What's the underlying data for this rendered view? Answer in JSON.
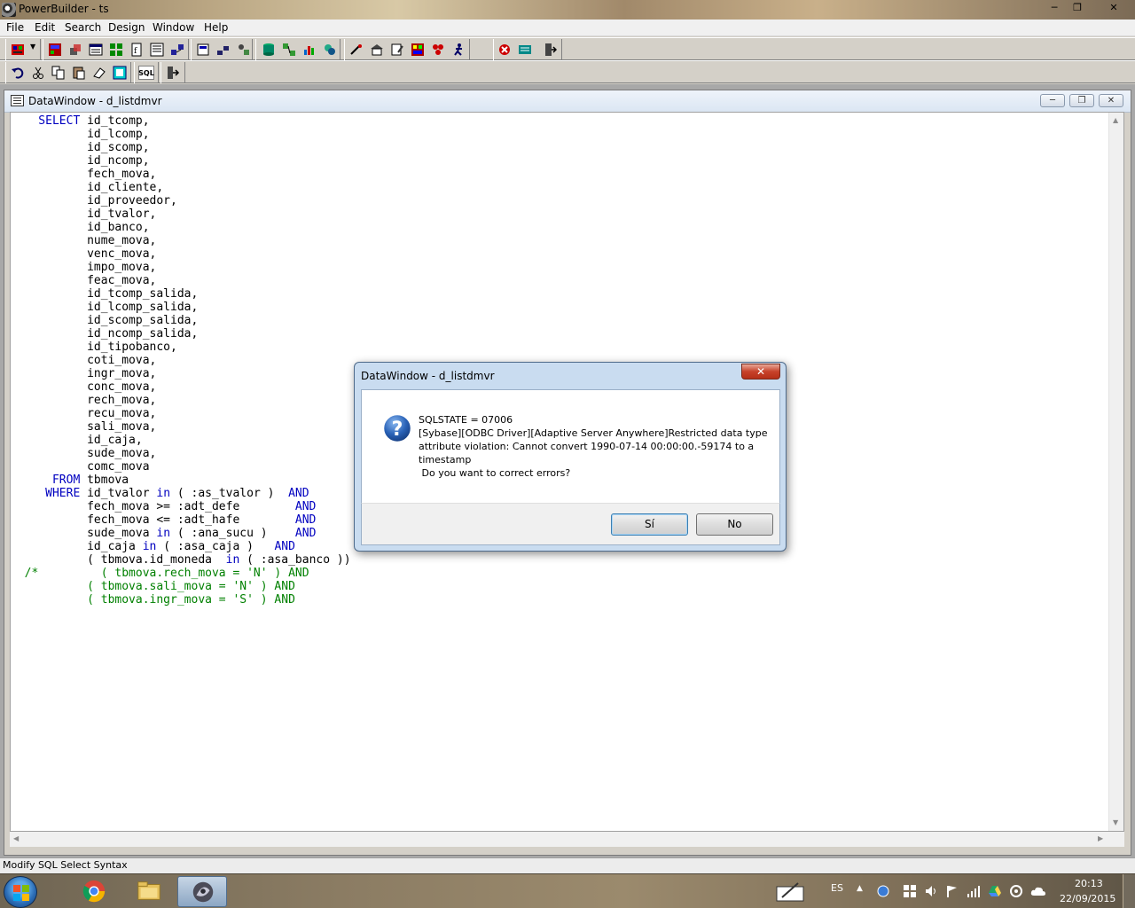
{
  "app": {
    "title": "PowerBuilder - ts",
    "menus": [
      "File",
      "Edit",
      "Search",
      "Design",
      "Window",
      "Help"
    ],
    "minimize": "─",
    "maximize": "❐",
    "close": "✕"
  },
  "toolbar2": {
    "sql_label": "SQL"
  },
  "child": {
    "title": "DataWindow - d_listdmvr",
    "minimize": "─",
    "restore": "❐",
    "close": "✕"
  },
  "editor": {
    "lines": [
      "    SELECT id_tcomp,",
      "           id_lcomp,",
      "           id_scomp,",
      "           id_ncomp,",
      "           fech_mova,",
      "           id_cliente,",
      "           id_proveedor,",
      "           id_tvalor,",
      "           id_banco,",
      "           nume_mova,",
      "           venc_mova,",
      "           impo_mova,",
      "           feac_mova,",
      "           id_tcomp_salida,",
      "           id_lcomp_salida,",
      "           id_scomp_salida,",
      "           id_ncomp_salida,",
      "           id_tipobanco,",
      "           coti_mova,",
      "           ingr_mova,",
      "           conc_mova,",
      "           rech_mova,",
      "           recu_mova,",
      "           sali_mova,",
      "           id_caja,",
      "           sude_mova,",
      "           comc_mova",
      "      FROM tbmova",
      "     WHERE id_tvalor in ( :as_tvalor )  AND",
      "           fech_mova >= :adt_defe        AND",
      "           fech_mova <= :adt_hafe        AND",
      "           sude_mova in ( :ana_sucu )    AND",
      "           id_caja in ( :asa_caja )   AND",
      "           ( tbmova.id_moneda  in ( :asa_banco ))",
      "  /*         ( tbmova.rech_mova = 'N' ) AND",
      "           ( tbmova.sali_mova = 'N' ) AND",
      "           ( tbmova.ingr_mova = 'S' ) AND"
    ]
  },
  "status": {
    "text": "Modify SQL Select Syntax"
  },
  "dialog": {
    "title": "DataWindow - d_listdmvr",
    "close": "✕",
    "lines": [
      "SQLSTATE = 07006",
      "[Sybase][ODBC Driver][Adaptive Server Anywhere]Restricted data type",
      "attribute violation: Cannot convert 1990-07-14 00:00:00.-59174 to a",
      "timestamp",
      " Do you want to correct errors?"
    ],
    "yes_label": "Sí",
    "no_label": "No"
  },
  "taskbar": {
    "language": "ES",
    "time": "20:13",
    "date": "22/09/2015"
  }
}
